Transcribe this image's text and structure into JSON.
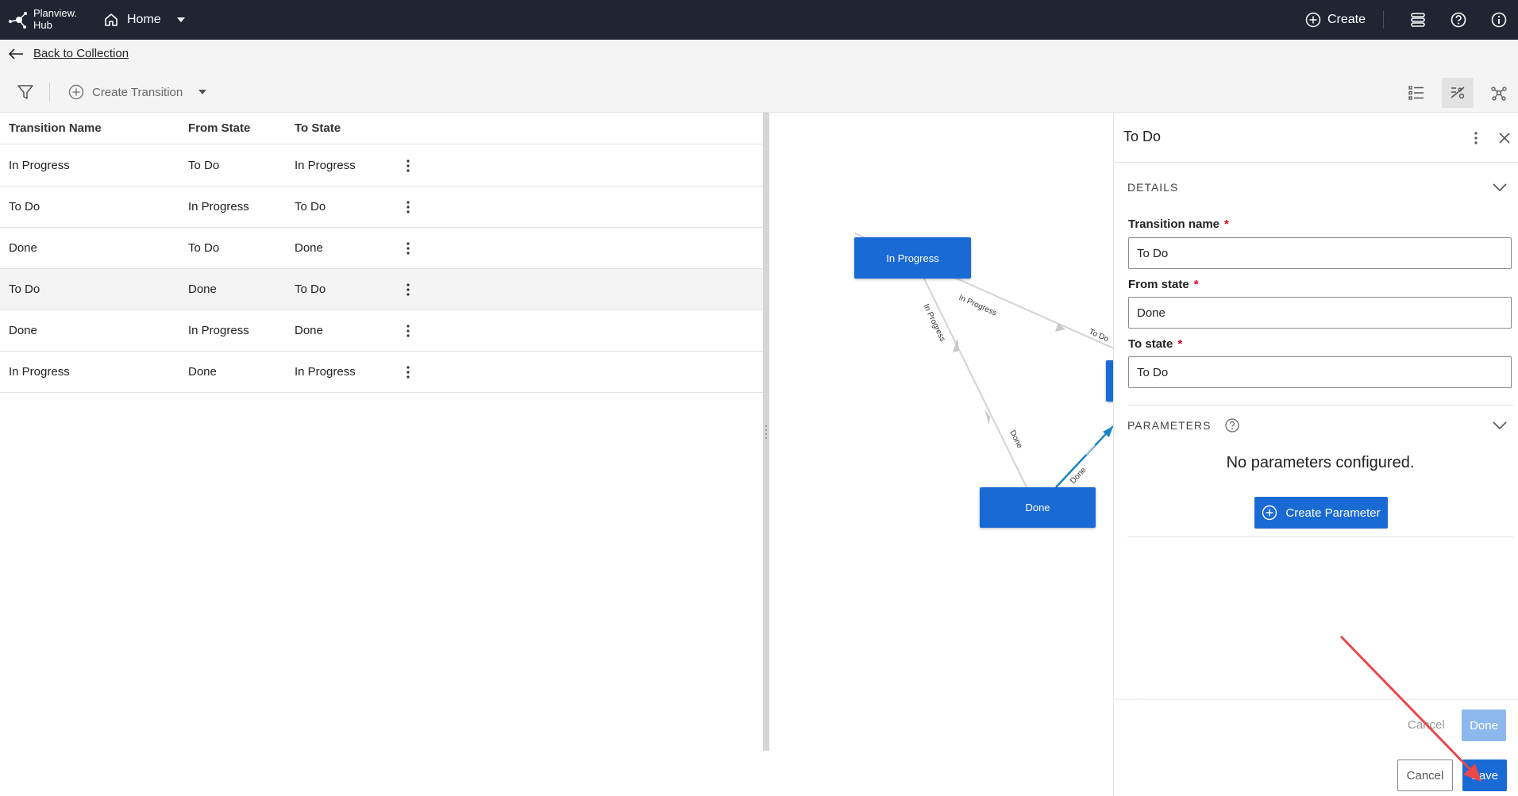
{
  "app": {
    "logo_text": "Planview.\nHub",
    "home_label": "Home",
    "create_label": "Create"
  },
  "backbar": {
    "back_label": "Back to Collection"
  },
  "toolbar": {
    "create_transition_label": "Create Transition"
  },
  "table": {
    "headers": [
      "Transition Name",
      "From State",
      "To State"
    ],
    "rows": [
      {
        "name": "In Progress",
        "from": "To Do",
        "to": "In Progress"
      },
      {
        "name": "To Do",
        "from": "In Progress",
        "to": "To Do"
      },
      {
        "name": "Done",
        "from": "To Do",
        "to": "Done"
      },
      {
        "name": "To Do",
        "from": "Done",
        "to": "To Do"
      },
      {
        "name": "Done",
        "from": "In Progress",
        "to": "Done"
      },
      {
        "name": "In Progress",
        "from": "Done",
        "to": "In Progress"
      }
    ]
  },
  "graph": {
    "nodes": [
      "In Progress",
      "Done"
    ],
    "edge_labels": [
      "In Progress",
      "To Do",
      "In Progress",
      "Done",
      "Done"
    ]
  },
  "panel": {
    "title": "To Do",
    "details_heading": "DETAILS",
    "transition_name_label": "Transition name",
    "transition_name_value": "To Do",
    "from_state_label": "From state",
    "from_state_value": "Done",
    "to_state_label": "To state",
    "to_state_value": "To Do",
    "required_mark": "*",
    "parameters_heading": "PARAMETERS",
    "no_params_text": "No parameters configured.",
    "create_param_label": "Create Parameter"
  },
  "footer": {
    "ghost_cancel": "Cancel",
    "ghost_done": "Done",
    "cancel": "Cancel",
    "save": "Save"
  },
  "colors": {
    "topbar": "#1f2533",
    "primary": "#1a6ad5",
    "annotation_arrow": "#e8474b"
  }
}
